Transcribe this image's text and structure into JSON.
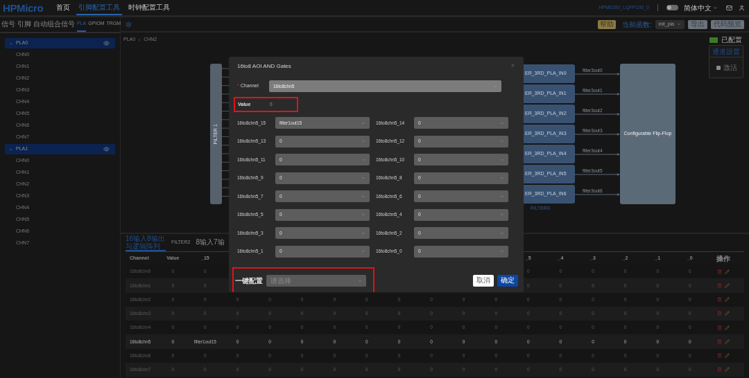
{
  "header": {
    "logo": "HPMicro",
    "nav": [
      {
        "label": "首页",
        "selected": false
      },
      {
        "label": "引脚配置工具",
        "selected": true
      },
      {
        "label": "时钟配置工具",
        "selected": false
      }
    ],
    "device": "HPM6280_LQFP100_0",
    "theme_toggle": {
      "on": false
    },
    "language": "简体中文"
  },
  "sidebar": {
    "tabs": [
      {
        "label": "信号",
        "selected": false
      },
      {
        "label": "引脚",
        "selected": false
      },
      {
        "label": "自动组合信号",
        "selected": false
      },
      {
        "label": "PLA",
        "selected": true
      },
      {
        "label": "GPIOM",
        "selected": false
      },
      {
        "label": "TRGM",
        "selected": false
      }
    ],
    "tree": [
      {
        "label": "PLA0",
        "expanded": true,
        "children": [
          {
            "label": "CHN0"
          },
          {
            "label": "CHN1"
          },
          {
            "label": "CHN2"
          },
          {
            "label": "CHN3"
          },
          {
            "label": "CHN4"
          },
          {
            "label": "CHN5"
          },
          {
            "label": "CHN6"
          },
          {
            "label": "CHN7"
          }
        ]
      },
      {
        "label": "PLA1",
        "expanded": true,
        "children": [
          {
            "label": "CHN0"
          },
          {
            "label": "CHN1"
          },
          {
            "label": "CHN2"
          },
          {
            "label": "CHN3"
          },
          {
            "label": "CHN4"
          },
          {
            "label": "CHN5"
          },
          {
            "label": "CHN6"
          },
          {
            "label": "CHN7"
          }
        ]
      }
    ]
  },
  "toolbar": {
    "help": "帮助",
    "function_label": "当前函数:",
    "function_value": "init_pla",
    "buttons": [
      "导出",
      "代码预览"
    ]
  },
  "breadcrumb": [
    "PLA0",
    "CHN2"
  ],
  "legend": {
    "label": "已配置",
    "color": "#3e7a26"
  },
  "channel_settings": {
    "title": "通道设置",
    "options": [
      {
        "label": "激活",
        "checked": false
      }
    ]
  },
  "diagram": {
    "filter1": "FILTER 1",
    "group_label": "FILTER3",
    "target": "Configurable Flip-Flop",
    "inputs": [
      {
        "block": "ER_3RD_PLA_IN0",
        "signal": "filter3out0"
      },
      {
        "block": "ER_3RD_PLA_IN1",
        "signal": "filter3out1"
      },
      {
        "block": "ER_3RD_PLA_IN2",
        "signal": "filter3out2"
      },
      {
        "block": "ER_3RD_PLA_IN3",
        "signal": "filter3out3"
      },
      {
        "block": "ER_3RD_PLA_IN4",
        "signal": "filter3out4"
      },
      {
        "block": "ER_3RD_PLA_IN5",
        "signal": "filter3out5"
      },
      {
        "block": "ER_3RD_PLA_IN6",
        "signal": "filter3out6"
      }
    ]
  },
  "bottom": {
    "tabs": [
      {
        "label": "16输入8输出与逻辑阵列",
        "selected": true
      },
      {
        "label": "FILTER2",
        "selected": false
      },
      {
        "label": "8输入7输",
        "selected": false
      }
    ],
    "table": {
      "columns": [
        "Channel",
        "Value",
        "_15",
        null,
        null,
        null,
        null,
        null,
        null,
        null,
        null,
        null,
        "_5",
        "_4",
        "_3",
        "_2",
        "_1",
        "_0",
        "操作"
      ],
      "rows": [
        {
          "selected": false,
          "cells": [
            "16to8chn0",
            "0",
            "0",
            null,
            null,
            null,
            null,
            null,
            null,
            null,
            null,
            null,
            "0",
            "0",
            "0",
            "0",
            "0",
            "0"
          ]
        },
        {
          "selected": false,
          "cells": [
            "16to8chn1",
            "0",
            "0",
            null,
            null,
            null,
            null,
            null,
            null,
            null,
            null,
            null,
            "0",
            "0",
            "0",
            "0",
            "0",
            "0"
          ]
        },
        {
          "selected": false,
          "cells": [
            "16to8chn2",
            "0",
            "0",
            "0",
            "0",
            "0",
            "0",
            "0",
            "0",
            "0",
            "0",
            "0",
            "0",
            "0",
            "0",
            "0",
            "0",
            "0"
          ]
        },
        {
          "selected": false,
          "cells": [
            "16to8chn3",
            "0",
            "0",
            "0",
            "0",
            "0",
            "0",
            "0",
            "0",
            "0",
            "0",
            "0",
            "0",
            "0",
            "0",
            "0",
            "0",
            "0"
          ]
        },
        {
          "selected": false,
          "cells": [
            "16to8chn4",
            "0",
            "0",
            "0",
            "0",
            "0",
            "0",
            "0",
            "0",
            "0",
            "0",
            "0",
            "0",
            "0",
            "0",
            "0",
            "0",
            "0"
          ]
        },
        {
          "selected": true,
          "cells": [
            "16to8chn5",
            "0",
            "filter1out15",
            "0",
            "0",
            "0",
            "0",
            "0",
            "0",
            "0",
            "0",
            "0",
            "0",
            "0",
            "0",
            "0",
            "0",
            "0"
          ]
        },
        {
          "selected": false,
          "cells": [
            "16to8chn6",
            "0",
            "0",
            "0",
            "0",
            "0",
            "0",
            "0",
            "0",
            "0",
            "0",
            "0",
            "0",
            "0",
            "0",
            "0",
            "0",
            "0"
          ]
        },
        {
          "selected": false,
          "cells": [
            "16to8chn7",
            "0",
            "0",
            "0",
            "0",
            "0",
            "0",
            "0",
            "0",
            "0",
            "0",
            "0",
            "0",
            "0",
            "0",
            "0",
            "0",
            "0"
          ]
        }
      ]
    }
  },
  "dialog": {
    "title": "16to8 AOI AND Gates",
    "channel": {
      "label": "Channel",
      "required_mark": "*",
      "value": "16to8chn5",
      "disabled": true
    },
    "value_field": {
      "label": "Value",
      "value": "0",
      "highlighted": true
    },
    "fields": [
      {
        "label": "16to8chn5_15",
        "value": "filter1out15"
      },
      {
        "label": "16to8chn5_14",
        "value": "0"
      },
      {
        "label": "16to8chn5_13",
        "value": "0"
      },
      {
        "label": "16to8chn5_12",
        "value": "0"
      },
      {
        "label": "16to8chn5_11",
        "value": "0"
      },
      {
        "label": "16to8chn5_10",
        "value": "0"
      },
      {
        "label": "16to8chn5_9",
        "value": "0"
      },
      {
        "label": "16to8chn5_8",
        "value": "0"
      },
      {
        "label": "16to8chn5_7",
        "value": "0"
      },
      {
        "label": "16to8chn5_6",
        "value": "0"
      },
      {
        "label": "16to8chn5_5",
        "value": "0"
      },
      {
        "label": "16to8chn5_4",
        "value": "0"
      },
      {
        "label": "16to8chn5_3",
        "value": "0"
      },
      {
        "label": "16to8chn5_2",
        "value": "0"
      },
      {
        "label": "16to8chn5_1",
        "value": "0"
      },
      {
        "label": "16to8chn5_0",
        "value": "0"
      }
    ],
    "quick_config": {
      "label": "一键配置",
      "placeholder": "请选择",
      "highlighted": true
    },
    "buttons": [
      {
        "label": "取消",
        "kind": "secondary"
      },
      {
        "label": "确定",
        "kind": "primary"
      }
    ]
  }
}
